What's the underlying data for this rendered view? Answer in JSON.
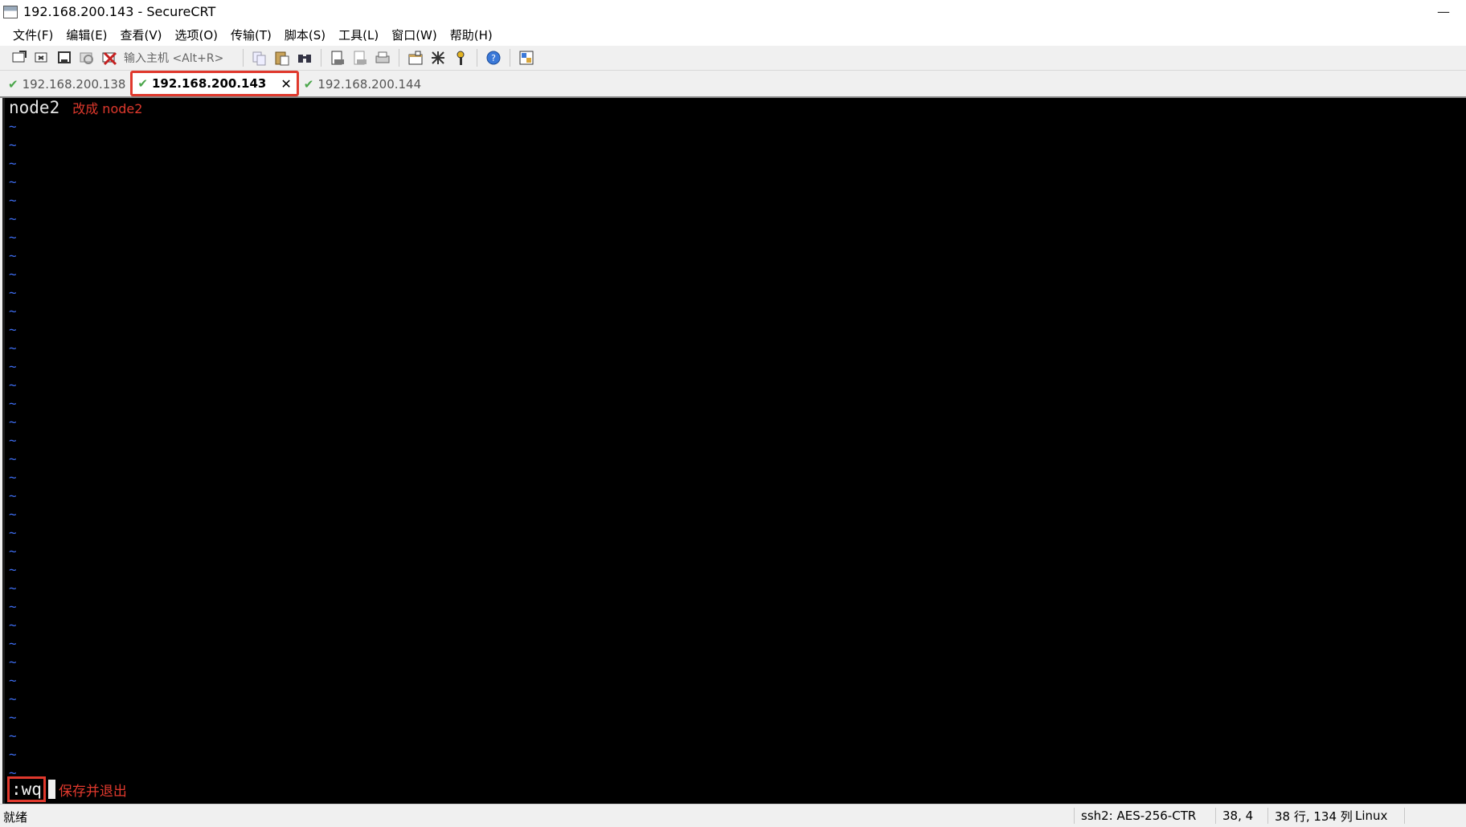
{
  "window": {
    "title": "192.168.200.143 - SecureCRT",
    "minimize": "—"
  },
  "menu": [
    "文件(F)",
    "编辑(E)",
    "查看(V)",
    "选项(O)",
    "传输(T)",
    "脚本(S)",
    "工具(L)",
    "窗口(W)",
    "帮助(H)"
  ],
  "toolbar": {
    "quick_connect_placeholder": "输入主机 <Alt+R>",
    "icons_left": [
      "connect-icon",
      "quick-connect-icon",
      "connect-tab-icon",
      "reconnect-icon",
      "disconnect-icon"
    ],
    "icons_right": [
      "copy-icon",
      "paste-icon",
      "find-icon",
      "print-icon",
      "print-setup-icon",
      "print-selection-icon",
      "session-options-icon",
      "global-options-icon",
      "keymap-icon",
      "help-icon",
      "sftp-icon"
    ]
  },
  "tabs": [
    {
      "label": "192.168.200.138",
      "active": false
    },
    {
      "label": "192.168.200.143",
      "active": true,
      "close": "✕"
    },
    {
      "label": "192.168.200.144",
      "active": false
    }
  ],
  "terminal": {
    "first_line": "node2",
    "annotation_first": "改成 node2",
    "tilde": "~",
    "command": ":wq",
    "annotation_command": "保存并退出"
  },
  "status": {
    "ready": "就绪",
    "cipher": "ssh2: AES-256-CTR",
    "cursor_pos": "38,  4",
    "size": "38 行, 134 列",
    "os": "Linux"
  },
  "colors": {
    "annotation": "#e0392d",
    "tilde": "#3d6cf0",
    "check": "#4aa64a"
  }
}
